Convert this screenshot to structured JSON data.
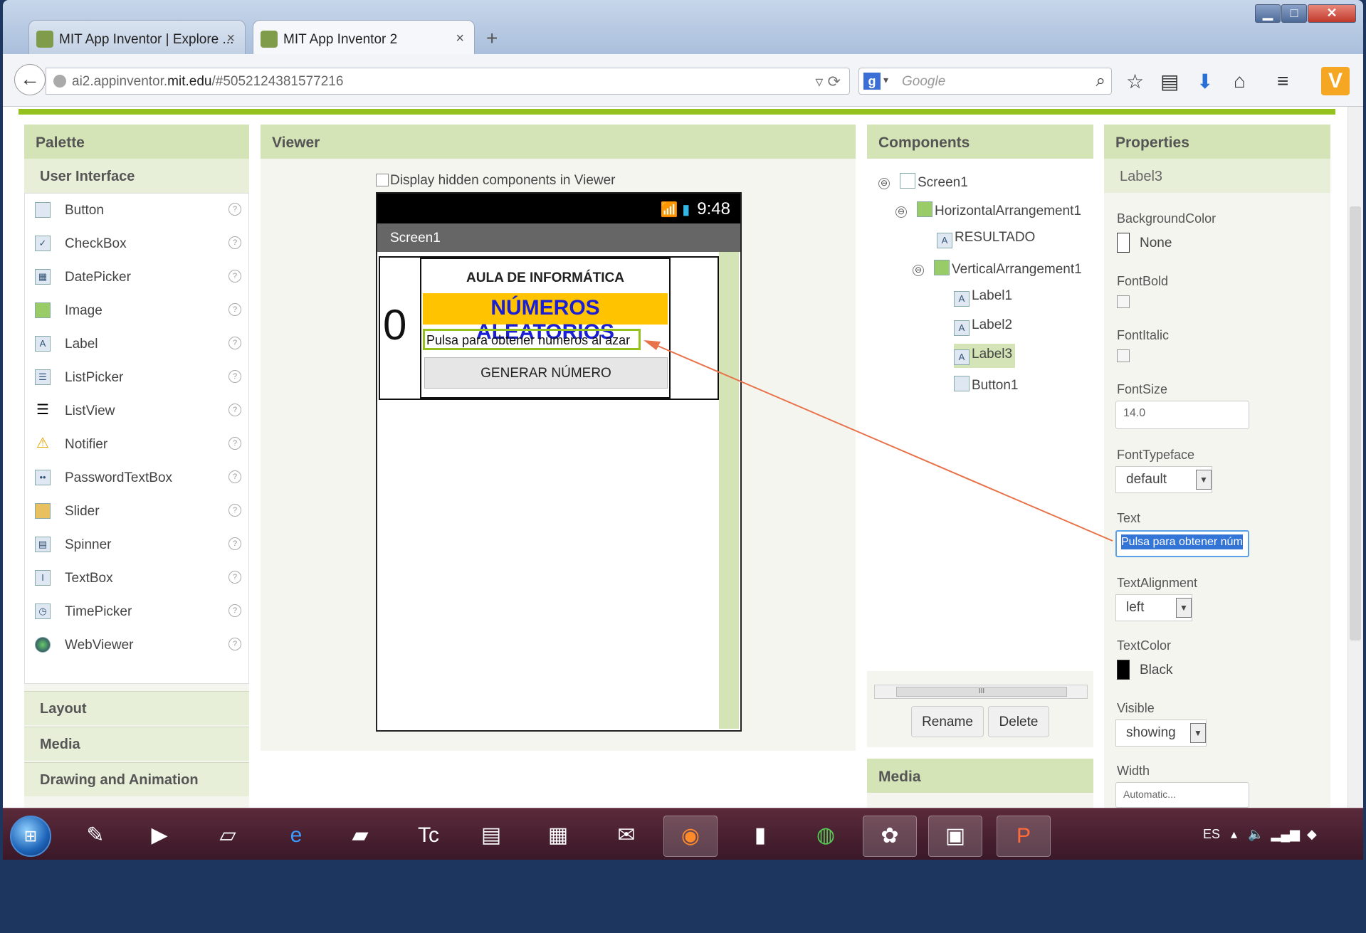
{
  "browser": {
    "tabs": [
      {
        "label": "MIT App Inventor | Explore ...",
        "close": "×"
      },
      {
        "label": "MIT App Inventor 2",
        "close": "×"
      }
    ],
    "new_tab": "+",
    "url_host": "ai2.appinventor.",
    "url_domain": "mit.edu",
    "url_path": "/#5052124381577216",
    "search_placeholder": "Google",
    "window_buttons": {
      "min": "▁",
      "max": "□",
      "close": "✕"
    }
  },
  "palette": {
    "title": "Palette",
    "section": "User Interface",
    "items": [
      {
        "label": "Button",
        "icon": "button-icon"
      },
      {
        "label": "CheckBox",
        "icon": "checkbox-icon"
      },
      {
        "label": "DatePicker",
        "icon": "datepicker-icon"
      },
      {
        "label": "Image",
        "icon": "image-icon"
      },
      {
        "label": "Label",
        "icon": "label-icon"
      },
      {
        "label": "ListPicker",
        "icon": "listpicker-icon"
      },
      {
        "label": "ListView",
        "icon": "listview-icon"
      },
      {
        "label": "Notifier",
        "icon": "notifier-icon"
      },
      {
        "label": "PasswordTextBox",
        "icon": "password-icon"
      },
      {
        "label": "Slider",
        "icon": "slider-icon"
      },
      {
        "label": "Spinner",
        "icon": "spinner-icon"
      },
      {
        "label": "TextBox",
        "icon": "textbox-icon"
      },
      {
        "label": "TimePicker",
        "icon": "timepicker-icon"
      },
      {
        "label": "WebViewer",
        "icon": "webviewer-icon"
      }
    ],
    "help": "?",
    "sections": [
      "Layout",
      "Media",
      "Drawing and Animation"
    ]
  },
  "viewer": {
    "title": "Viewer",
    "hidden_checkbox": "Display hidden components in Viewer",
    "time": "9:48",
    "screen_title": "Screen1",
    "resultado": "0",
    "label1": "AULA DE INFORMÁTICA",
    "label2": "NÚMEROS ALEATORIOS",
    "label3": "Pulsa para obtener números al azar",
    "button1": "GENERAR NÚMERO",
    "label2_bg": "#ffc300",
    "label2_fg": "#1a1fd6"
  },
  "components": {
    "title": "Components",
    "tree": {
      "screen": "Screen1",
      "harr": "HorizontalArrangement1",
      "resultado": "RESULTADO",
      "varr": "VerticalArrangement1",
      "label1": "Label1",
      "label2": "Label2",
      "label3": "Label3",
      "button1": "Button1"
    },
    "toggle": "⊖",
    "scroll_grip": "III",
    "rename": "Rename",
    "delete": "Delete",
    "media": "Media"
  },
  "properties": {
    "title": "Properties",
    "selected": "Label3",
    "bgcolor_label": "BackgroundColor",
    "bgcolor_value": "None",
    "fontbold_label": "FontBold",
    "fontitalic_label": "FontItalic",
    "fontsize_label": "FontSize",
    "fontsize_value": "14.0",
    "typeface_label": "FontTypeface",
    "typeface_value": "default",
    "text_label": "Text",
    "text_value": "Pulsa para obtener núm",
    "align_label": "TextAlignment",
    "align_value": "left",
    "textcolor_label": "TextColor",
    "textcolor_value": "Black",
    "visible_label": "Visible",
    "visible_value": "showing",
    "width_label": "Width",
    "width_value": "Automatic..."
  },
  "taskbar": {
    "lang": "ES",
    "apps": [
      "paint-icon",
      "media-player-icon",
      "notepad-icon",
      "ie-icon",
      "folder-note-icon",
      "turbo-c-icon",
      "editor-icon",
      "explorer-icon",
      "mail-icon",
      "firefox-icon",
      "book-icon",
      "chrome-icon",
      "palette-icon",
      "computer-icon",
      "powerpoint-icon"
    ]
  },
  "colors": {
    "accent_green": "#95c11f",
    "panel_header": "#d4e4b7"
  }
}
